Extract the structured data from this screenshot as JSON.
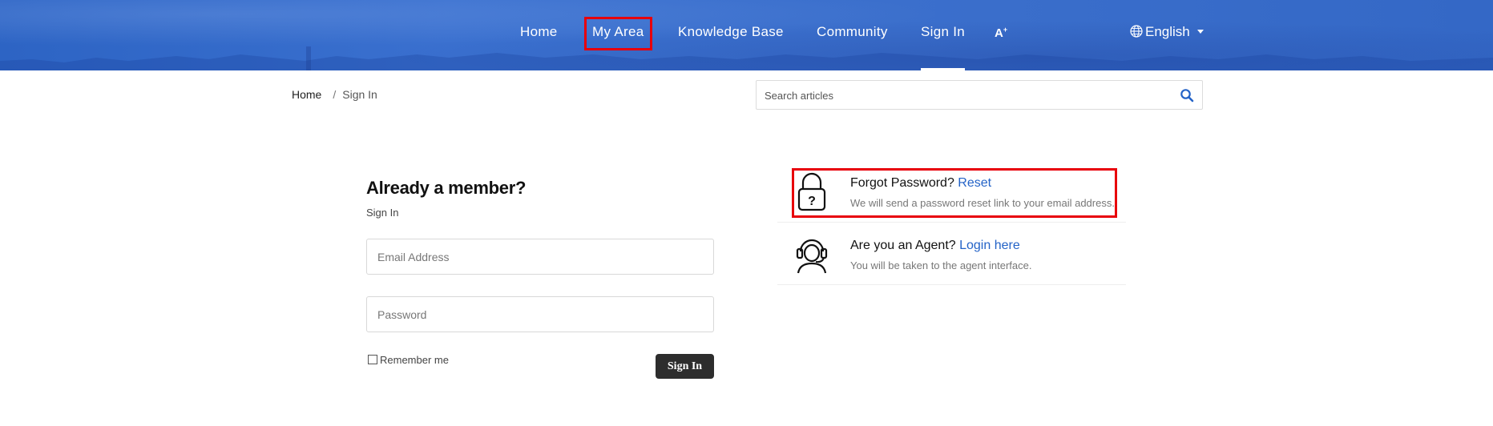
{
  "nav": {
    "home": "Home",
    "my_area": "My Area",
    "knowledge_base": "Knowledge Base",
    "community": "Community",
    "sign_in": "Sign In",
    "accessibility": "A",
    "language": "English"
  },
  "breadcrumb": {
    "home": "Home",
    "separator": "/",
    "current": "Sign In"
  },
  "search": {
    "placeholder": "Search articles"
  },
  "login": {
    "title": "Already a member?",
    "subtitle": "Sign In",
    "email_placeholder": "Email Address",
    "password_placeholder": "Password",
    "remember_label": "Remember me",
    "submit_label": "Sign In"
  },
  "help": {
    "forgot": {
      "title": "Forgot Password?",
      "link": "Reset",
      "description": "We will send a password reset link to your email address."
    },
    "agent": {
      "title": "Are you an Agent?",
      "link": "Login here",
      "description": "You will be taken to the agent interface."
    }
  },
  "colors": {
    "header_blue": "#3a6fcc",
    "link_blue": "#2463c7",
    "highlight_red": "#e8000b",
    "button_dark": "#2d2d2d"
  }
}
